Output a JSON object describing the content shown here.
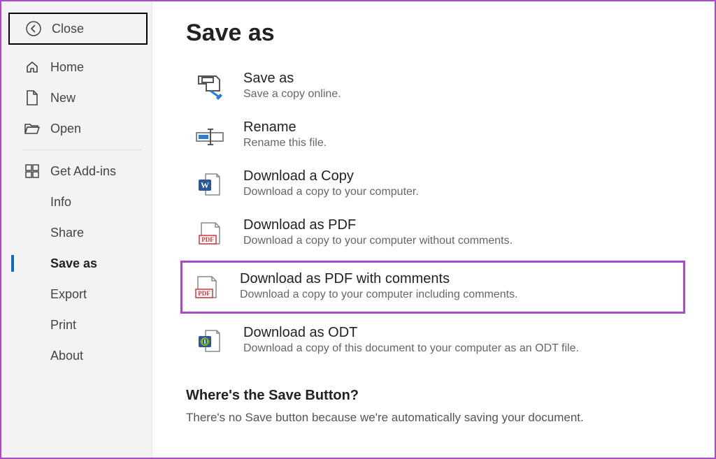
{
  "sidebar": {
    "close": "Close",
    "home": "Home",
    "new": "New",
    "open": "Open",
    "get_addins": "Get Add-ins",
    "info": "Info",
    "share": "Share",
    "save_as": "Save as",
    "export": "Export",
    "print": "Print",
    "about": "About"
  },
  "page": {
    "title": "Save as",
    "options": {
      "save_as": {
        "title": "Save as",
        "desc": "Save a copy online."
      },
      "rename": {
        "title": "Rename",
        "desc": "Rename this file."
      },
      "download_copy": {
        "title": "Download a Copy",
        "desc": "Download a copy to your computer."
      },
      "download_pdf": {
        "title": "Download as PDF",
        "desc": "Download a copy to your computer without comments."
      },
      "download_pdf_comments": {
        "title": "Download as PDF with comments",
        "desc": "Download a copy to your computer including comments."
      },
      "download_odt": {
        "title": "Download as ODT",
        "desc": "Download a copy of this document to your computer as an ODT file."
      }
    },
    "footer": {
      "heading": "Where's the Save Button?",
      "text": "There's no Save button because we're automatically saving your document."
    }
  }
}
